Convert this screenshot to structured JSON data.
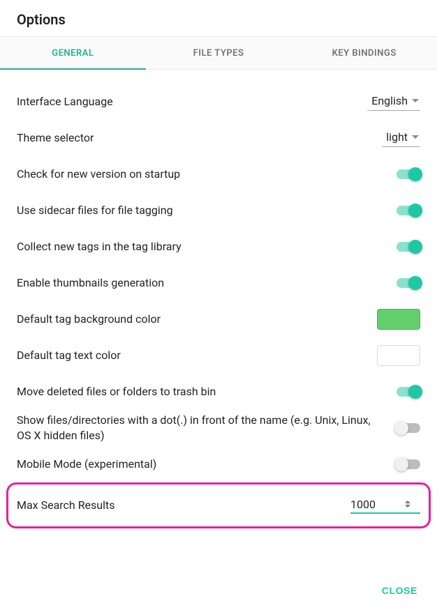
{
  "title": "Options",
  "tabs": {
    "general": "GENERAL",
    "filetypes": "FILE TYPES",
    "keybindings": "KEY BINDINGS"
  },
  "rows": {
    "language": {
      "label": "Interface Language",
      "value": "English"
    },
    "theme": {
      "label": "Theme selector",
      "value": "light"
    },
    "check_update": {
      "label": "Check for new version on startup"
    },
    "sidecar": {
      "label": "Use sidecar files for file tagging"
    },
    "collect_tags": {
      "label": "Collect new tags in the tag library"
    },
    "thumbnails": {
      "label": "Enable thumbnails generation"
    },
    "tag_bg": {
      "label": "Default tag background color",
      "color": "#62cf6c"
    },
    "tag_fg": {
      "label": "Default tag text color",
      "color": "#ffffff"
    },
    "trash": {
      "label": "Move deleted files or folders to trash bin"
    },
    "hidden": {
      "label": "Show files/directories with a dot(.) in front of the name (e.g. Unix, Linux, OS X hidden files)"
    },
    "mobile": {
      "label": "Mobile Mode (experimental)"
    },
    "max_search": {
      "label": "Max Search Results",
      "value": "1000"
    }
  },
  "footer": {
    "close": "CLOSE"
  }
}
